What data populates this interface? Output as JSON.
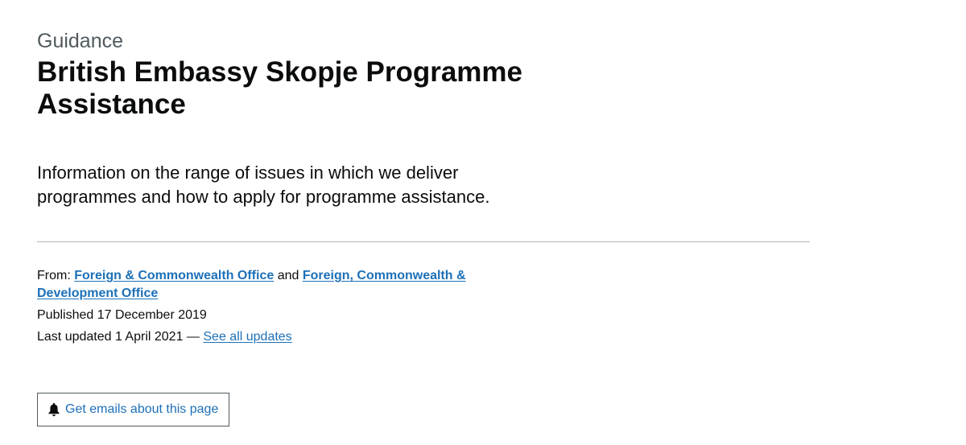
{
  "header": {
    "caption": "Guidance",
    "title": "British Embassy Skopje Programme Assistance"
  },
  "lead": "Information on the range of issues in which we deliver programmes and how to apply for programme assistance.",
  "metadata": {
    "from_label": "From:",
    "organisations": [
      "Foreign & Commonwealth Office",
      "Foreign, Commonwealth & Development Office"
    ],
    "and_text": "and",
    "published": "Published 17 December 2019",
    "last_updated": "Last updated 1 April 2021 —",
    "see_all_updates": "See all updates"
  },
  "email_button": {
    "label": "Get emails about this page",
    "icon": "bell-icon"
  },
  "colors": {
    "link": "#1d70b8",
    "text": "#0b0c0c",
    "secondary_text": "#505a5f",
    "divider": "#b1b4b6"
  }
}
